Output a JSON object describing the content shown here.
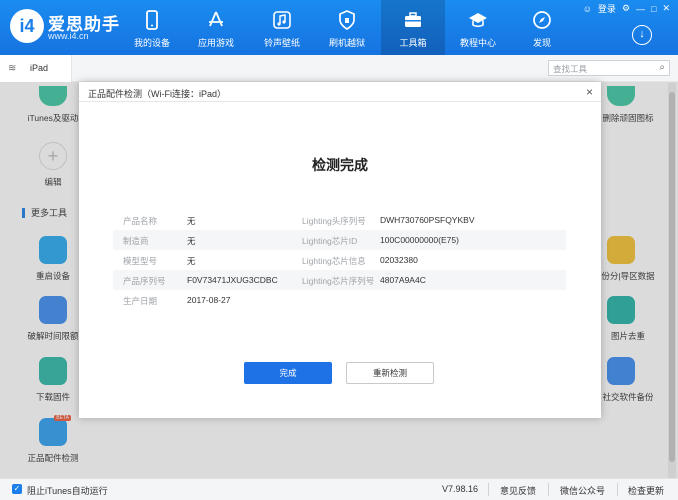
{
  "header": {
    "logo_glyph": "i4",
    "app_name": "爱思助手",
    "url": "www.i4.cn",
    "login": "登录",
    "nav": [
      {
        "label": "我的设备",
        "icon": "phone-icon"
      },
      {
        "label": "应用游戏",
        "icon": "app-store-icon"
      },
      {
        "label": "铃声壁纸",
        "icon": "music-icon"
      },
      {
        "label": "刷机越狱",
        "icon": "shield-icon"
      },
      {
        "label": "工具箱",
        "icon": "toolbox-icon"
      },
      {
        "label": "教程中心",
        "icon": "graduation-cap-icon"
      },
      {
        "label": "发现",
        "icon": "compass-icon"
      }
    ],
    "active_nav": "工具箱"
  },
  "device_bar": {
    "device_name": "iPad",
    "search_placeholder": "查找工具"
  },
  "background_tools": {
    "itunes_label": "iTunes及驱动",
    "edit_label": "编辑",
    "section_title": "更多工具",
    "left_tools": [
      {
        "label": "重启设备"
      },
      {
        "label": "破解时间限额"
      },
      {
        "label": "下载固件"
      },
      {
        "label": "正品配件检测",
        "badge": "BETA"
      }
    ],
    "right_tools": [
      {
        "label": "删除顽固图标"
      },
      {
        "label": "份分|导区数据"
      },
      {
        "label": "图片去重"
      },
      {
        "label": "社交软件备份"
      }
    ]
  },
  "dialog": {
    "title": "正品配件检测（Wi-Fi连接：iPad）",
    "close_glyph": "×",
    "heading": "检测完成",
    "rows": [
      {
        "left_label": "产品名称",
        "left_value": "无",
        "right_label": "Lighting头序列号",
        "right_value": "DWH730760PSFQYKBV"
      },
      {
        "left_label": "制造商",
        "left_value": "无",
        "right_label": "Lighting芯片ID",
        "right_value": "100C00000000(E75)"
      },
      {
        "left_label": "模型型号",
        "left_value": "无",
        "right_label": "Lighting芯片信息",
        "right_value": "02032380"
      },
      {
        "left_label": "产品序列号",
        "left_value": "F0V73471JXUG3CDBC",
        "right_label": "Lighting芯片序列号",
        "right_value": "4807A9A4C"
      },
      {
        "left_label": "生产日期",
        "left_value": "2017-08-27",
        "right_label": "",
        "right_value": ""
      }
    ],
    "primary_button": "完成",
    "secondary_button": "重新检测"
  },
  "bottom_bar": {
    "checkbox_label": "阻止iTunes自动运行",
    "checkbox_checked": true,
    "version": "V7.98.16",
    "feedback": "意见反馈",
    "wechat": "微信公众号",
    "update": "检查更新"
  },
  "colors": {
    "brand_blue": "#1a7fe8",
    "primary_button": "#1f72e6"
  }
}
